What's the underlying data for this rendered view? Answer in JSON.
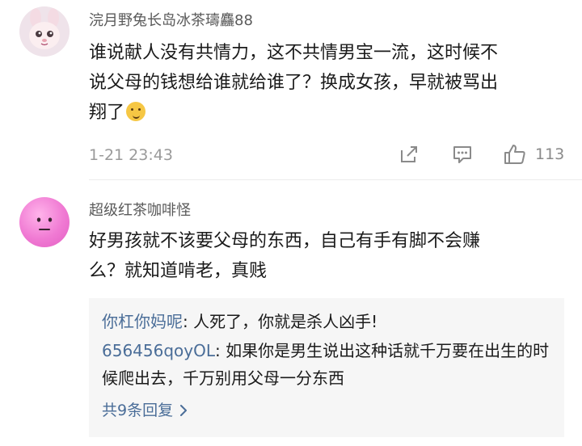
{
  "comments": [
    {
      "username": "浣月野兔长岛冰茶璹麤88",
      "content_lines": [
        "谁说献人没有共情力，这不共情男宝一流，这时候不",
        "说父母的钱想给谁就给谁了？换成女孩，早就被骂出",
        "翔了"
      ],
      "emoji": "yum-face-emoji",
      "time": "1-21 23:43",
      "likes": "113",
      "icons": {
        "share": "share-icon",
        "reply": "comment-icon",
        "like": "thumbs-up-icon"
      }
    },
    {
      "username": "超级红茶咖啡怪",
      "content_lines": [
        "好男孩就不该要父母的东西，自己有手有脚不会赚",
        "么？就知道啃老，真贱"
      ],
      "replies": [
        {
          "name": "你杠你妈呢",
          "text": ": 人死了，你就是杀人凶手!"
        },
        {
          "name": "656456qoyOL",
          "text": ": 如果你是男生说出这种话就千万要在出生的时候爬出去，千万别用父母一分东西"
        }
      ],
      "more_replies": "共9条回复",
      "more_icon": "chevron-right-icon"
    }
  ]
}
